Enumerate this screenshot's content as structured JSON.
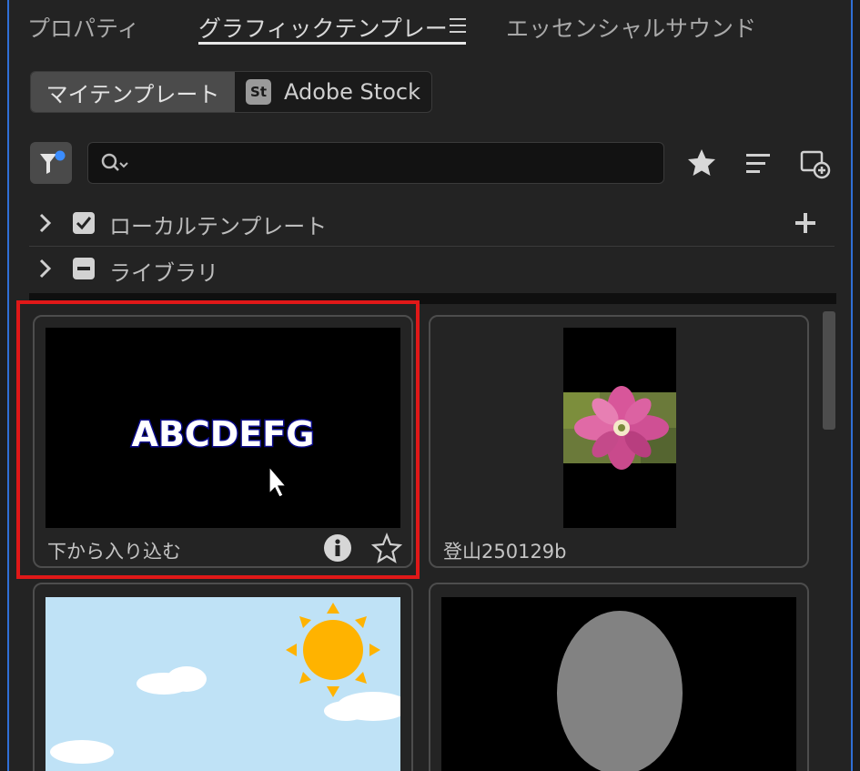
{
  "tabs": [
    {
      "label": "プロパティ"
    },
    {
      "label": "グラフィックテンプレート"
    },
    {
      "label": "エッセンシャルサウンド"
    }
  ],
  "active_tab_visible_label": "グラフィックテンプレー",
  "segments": {
    "my_templates": "マイテンプレート",
    "stock_badge": "St",
    "adobe_stock": "Adobe Stock"
  },
  "search": {
    "value": "",
    "placeholder": ""
  },
  "tree": [
    {
      "label": "ローカルテンプレート",
      "checked": true
    },
    {
      "label": "ライブラリ",
      "checked": "partial"
    }
  ],
  "cards": [
    {
      "thumb_text": "ABCDEFG",
      "label": "下から入り込む"
    },
    {
      "label": "登山250129b"
    },
    {
      "label": ""
    },
    {
      "label": ""
    }
  ],
  "colors": {
    "highlight": "#e01818",
    "accent_dot": "#3b8dff",
    "sun": "#ffb300",
    "sky": "#bfe2f6",
    "text_outline": "#0b0b8a"
  }
}
